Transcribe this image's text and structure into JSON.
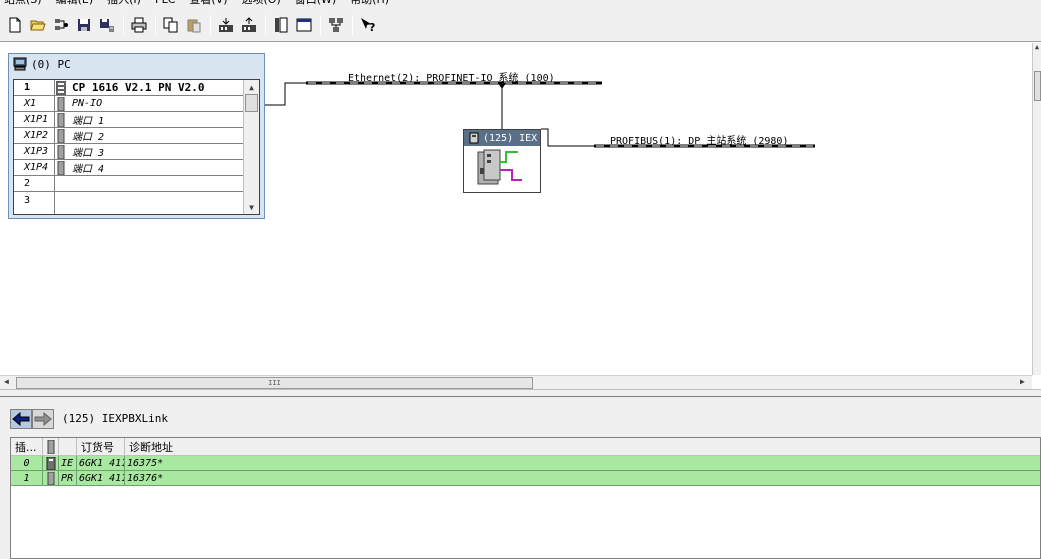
{
  "menu": [
    "站点(S)",
    "编辑(E)",
    "插入(I)",
    "PLC",
    "查看(V)",
    "选项(O)",
    "窗口(W)",
    "帮助(H)"
  ],
  "toolbar": {
    "icons": [
      "new-icon",
      "open-icon",
      "accessible-nodes-icon",
      "save-icon",
      "save-compile-icon",
      "print-icon",
      "copy-icon",
      "paste-icon",
      "download-icon",
      "upload-icon",
      "catalog-icon",
      "network-view-icon",
      "network-config-icon",
      "help-icon"
    ]
  },
  "station": {
    "title": "(0)  PC",
    "rows": [
      {
        "slot": "1",
        "name": "CP 1616 V2.1 PN V2.0",
        "bold": true
      },
      {
        "slot": "X1",
        "name": "PN-IO",
        "bold": false
      },
      {
        "slot": "X1P1",
        "name": "端口 1",
        "bold": false
      },
      {
        "slot": "X1P2",
        "name": "端口 2",
        "bold": false
      },
      {
        "slot": "X1P3",
        "name": "端口 3",
        "bold": false
      },
      {
        "slot": "X1P4",
        "name": "端口 4",
        "bold": false
      },
      {
        "slot": "2",
        "name": "",
        "bold": false
      },
      {
        "slot": "3",
        "name": "",
        "bold": false
      }
    ]
  },
  "networks": {
    "ethernet": "Ethernet(2): PROFINET-IO 系统 (100)",
    "profibus": "PROFIBUS(1): DP 主站系统 (2980)"
  },
  "device": {
    "title": "(125) IEX"
  },
  "hscroll": {
    "grip": "III"
  },
  "detail": {
    "title": "(125)   IEXPBXLink",
    "headers": [
      "插...",
      "",
      "",
      "订货号",
      "诊断地址"
    ],
    "rows": [
      {
        "slot": "0",
        "name": "IE",
        "order": "6GK1 411",
        "addr": "16375*"
      },
      {
        "slot": "1",
        "name": "PR",
        "order": "6GK1 411",
        "addr": "16376*"
      }
    ]
  },
  "colors": {
    "bus_line": "#000000",
    "row_green": "#a8e8a0",
    "station_frame": "#d8e4f0",
    "device_title": "#5a6f88"
  }
}
